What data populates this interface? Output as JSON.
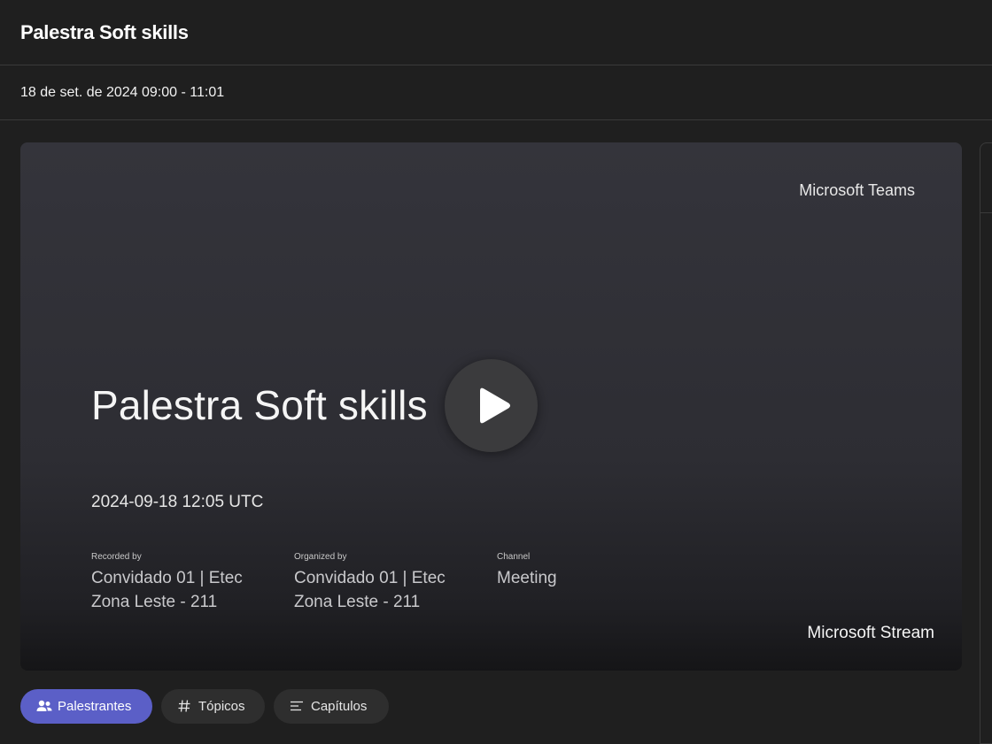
{
  "header": {
    "title": "Palestra Soft skills"
  },
  "subheader": {
    "date_range": "18 de set. de 2024 09:00 - 11:01"
  },
  "player": {
    "brand_top": "Microsoft Teams",
    "title": "Palestra Soft skills",
    "date": "2024-09-18 12:05 UTC",
    "recorded_by": {
      "label": "Recorded by",
      "line1": "Convidado 01 | Etec",
      "line2": "Zona Leste - 211"
    },
    "organized_by": {
      "label": "Organized by",
      "line1": "Convidado 01 | Etec",
      "line2": "Zona Leste - 211"
    },
    "channel": {
      "label": "Channel",
      "value": "Meeting"
    },
    "brand_bottom": "Microsoft Stream",
    "play_icon": "play-icon"
  },
  "tabs": [
    {
      "label": "Palestrantes",
      "icon": "people-icon",
      "active": true
    },
    {
      "label": "Tópicos",
      "icon": "hashtag-icon",
      "active": false
    },
    {
      "label": "Capítulos",
      "icon": "chapters-icon",
      "active": false
    }
  ],
  "colors": {
    "background": "#1f1f1f",
    "accent": "#5b5fc7",
    "tab_inactive": "#2e2e2e"
  }
}
